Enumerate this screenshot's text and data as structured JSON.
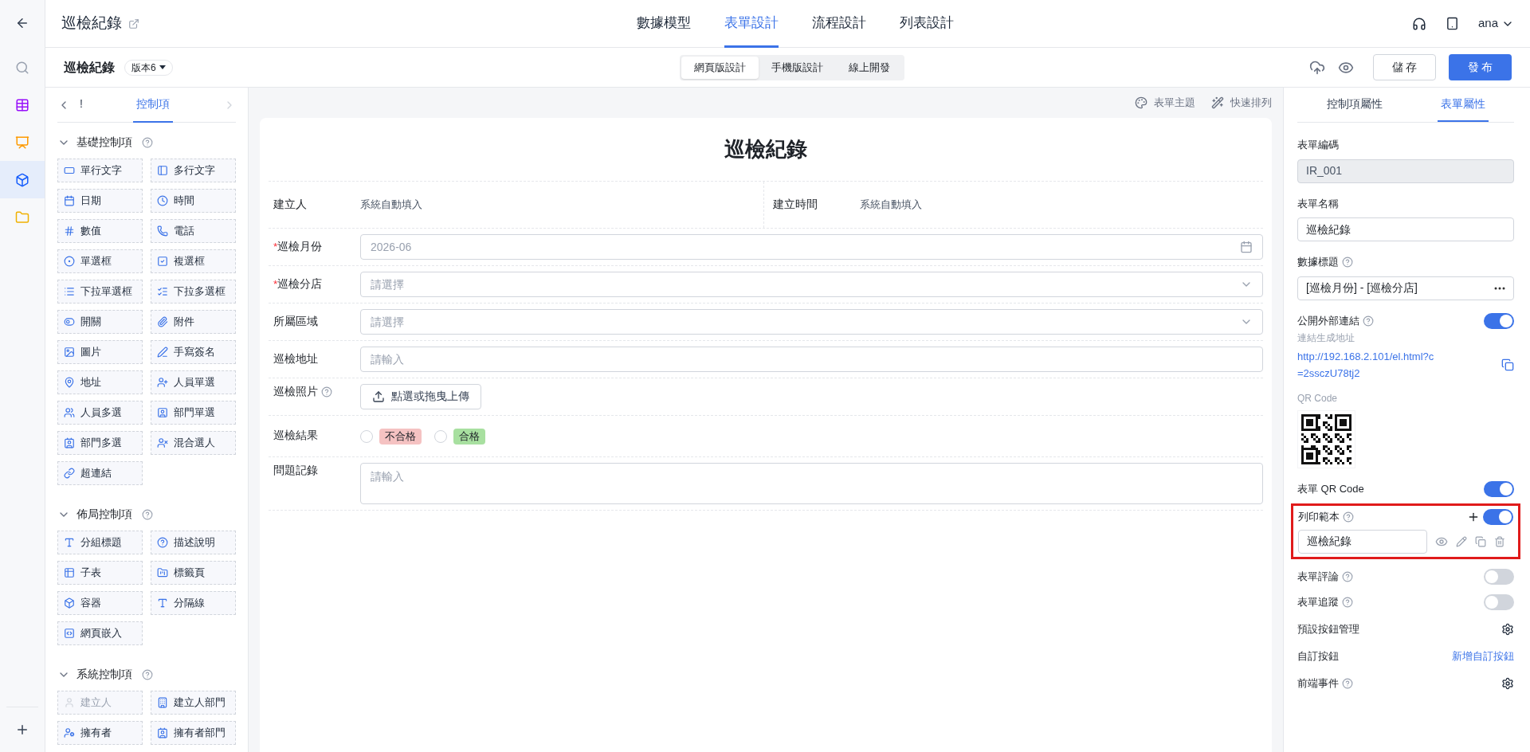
{
  "rail": {
    "items": [
      {
        "kind": "back",
        "selected": false
      },
      {
        "kind": "search",
        "selected": false
      },
      {
        "kind": "table",
        "selected": false
      },
      {
        "kind": "board",
        "selected": false
      },
      {
        "kind": "cube",
        "selected": true
      },
      {
        "kind": "folder",
        "selected": false
      }
    ],
    "add": {
      "kind": "plus"
    }
  },
  "header": {
    "title": "巡檢紀錄",
    "nav": [
      {
        "label": "數據模型",
        "selected": false
      },
      {
        "label": "表單設計",
        "selected": true
      },
      {
        "label": "流程設計",
        "selected": false
      },
      {
        "label": "列表設計",
        "selected": false
      }
    ],
    "user": "ana"
  },
  "subbar": {
    "name": "巡檢紀錄",
    "version": "版本6",
    "modes": [
      {
        "label": "網頁版設計",
        "selected": true
      },
      {
        "label": "手機版設計",
        "selected": false
      },
      {
        "label": "線上開發",
        "selected": false
      }
    ],
    "save": "儲 存",
    "publish": "發 布"
  },
  "controls": {
    "tabs": [
      {
        "label": "!",
        "selected": false
      },
      {
        "label": "控制項",
        "selected": true
      }
    ],
    "groups": [
      {
        "title": "基礎控制項",
        "expanded": true,
        "items": [
          {
            "label": "單行文字",
            "kind": "single",
            "disabled": false
          },
          {
            "label": "多行文字",
            "kind": "multi",
            "disabled": false
          },
          {
            "label": "日期",
            "kind": "date",
            "disabled": false
          },
          {
            "label": "時間",
            "kind": "time",
            "disabled": false
          },
          {
            "label": "數值",
            "kind": "number",
            "disabled": false
          },
          {
            "label": "電話",
            "kind": "phone",
            "disabled": false
          },
          {
            "label": "單選框",
            "kind": "radio",
            "disabled": false
          },
          {
            "label": "複選框",
            "kind": "checkbox",
            "disabled": false
          },
          {
            "label": "下拉單選框",
            "kind": "dropdown",
            "disabled": false
          },
          {
            "label": "下拉多選框",
            "kind": "multidropdown",
            "disabled": false
          },
          {
            "label": "開關",
            "kind": "switch",
            "disabled": false
          },
          {
            "label": "附件",
            "kind": "attach",
            "disabled": false
          },
          {
            "label": "圖片",
            "kind": "image",
            "disabled": false
          },
          {
            "label": "手寫簽名",
            "kind": "sign",
            "disabled": false
          },
          {
            "label": "地址",
            "kind": "address",
            "disabled": false
          },
          {
            "label": "人員單選",
            "kind": "user",
            "disabled": false
          },
          {
            "label": "人員多選",
            "kind": "users",
            "disabled": false
          },
          {
            "label": "部門單選",
            "kind": "dept",
            "disabled": false
          },
          {
            "label": "部門多選",
            "kind": "depts",
            "disabled": false
          },
          {
            "label": "混合選人",
            "kind": "mixed",
            "disabled": false
          },
          {
            "label": "超連結",
            "kind": "link",
            "disabled": false
          }
        ]
      },
      {
        "title": "佈局控制項",
        "expanded": true,
        "items": [
          {
            "label": "分組標題",
            "kind": "title",
            "disabled": false
          },
          {
            "label": "描述說明",
            "kind": "help",
            "disabled": false
          },
          {
            "label": "子表",
            "kind": "grid",
            "disabled": false
          },
          {
            "label": "標籤頁",
            "kind": "tabs",
            "disabled": false
          },
          {
            "label": "容器",
            "kind": "box",
            "disabled": false
          },
          {
            "label": "分隔線",
            "kind": "title",
            "disabled": false
          },
          {
            "label": "網頁嵌入",
            "kind": "embed",
            "disabled": false
          }
        ]
      },
      {
        "title": "系統控制項",
        "expanded": true,
        "items": [
          {
            "label": "建立人",
            "kind": "person",
            "disabled": true
          },
          {
            "label": "建立人部門",
            "kind": "org",
            "disabled": false
          },
          {
            "label": "擁有者",
            "kind": "owner",
            "disabled": false
          },
          {
            "label": "擁有者部門",
            "kind": "depts",
            "disabled": false
          }
        ]
      }
    ]
  },
  "canvas": {
    "tools": [
      {
        "label": "表單主題",
        "kind": "palette"
      },
      {
        "label": "快速排列",
        "kind": "wand"
      }
    ]
  },
  "form": {
    "title": "巡檢紀錄",
    "required_mark": "*",
    "rows": [
      {
        "kind": "pair",
        "fields": [
          {
            "label": "建立人",
            "value": "系統自動填入"
          },
          {
            "label": "建立時間",
            "value": "系統自動填入"
          }
        ]
      },
      {
        "kind": "date",
        "label": "巡檢月份",
        "required": true,
        "placeholder": "2026-06"
      },
      {
        "kind": "select",
        "label": "巡檢分店",
        "required": true,
        "placeholder": "請選擇"
      },
      {
        "kind": "select",
        "label": "所屬區域",
        "required": false,
        "placeholder": "請選擇"
      },
      {
        "kind": "input",
        "label": "巡檢地址",
        "required": false,
        "placeholder": "請輸入"
      },
      {
        "kind": "upload",
        "label": "巡檢照片",
        "required": false,
        "help": true,
        "button": "點選或拖曳上傳"
      },
      {
        "kind": "radio",
        "label": "巡檢結果",
        "required": false,
        "options": [
          {
            "label": "不合格",
            "color": "#f5c2c2",
            "selected": false
          },
          {
            "label": "合格",
            "color": "#a8e0a0",
            "selected": false
          }
        ]
      },
      {
        "kind": "textarea",
        "label": "問題記錄",
        "required": false,
        "placeholder": "請輸入"
      }
    ]
  },
  "properties": {
    "tabs": [
      {
        "label": "控制項屬性",
        "selected": false
      },
      {
        "label": "表單屬性",
        "selected": true
      }
    ],
    "code": {
      "label": "表單編碼",
      "value": "IR_001",
      "disabled": true
    },
    "name": {
      "label": "表單名稱",
      "value": "巡檢紀錄"
    },
    "data_title": {
      "label": "數據標題",
      "value": "[巡檢月份] - [巡檢分店]"
    },
    "public_link": {
      "label": "公開外部連結",
      "on": true,
      "sublabel": "連結生成地址",
      "url": "http://192.168.2.101/el.html?c=2ssczU78tj2"
    },
    "qr_label": "QR Code",
    "qr_toggle": {
      "label": "表單 QR Code",
      "on": true
    },
    "print": {
      "label": "列印範本",
      "on": true,
      "highlighted": true,
      "template": "巡檢紀錄"
    },
    "switches": [
      {
        "label": "表單評論",
        "on": false
      },
      {
        "label": "表單追蹤",
        "on": false
      }
    ],
    "settings": [
      {
        "label": "預設按鈕管理",
        "kind": "gear"
      },
      {
        "label": "自訂按鈕",
        "kind": "link",
        "link": "新增自訂按鈕"
      },
      {
        "label": "前端事件",
        "kind": "gear",
        "help": true
      }
    ]
  }
}
